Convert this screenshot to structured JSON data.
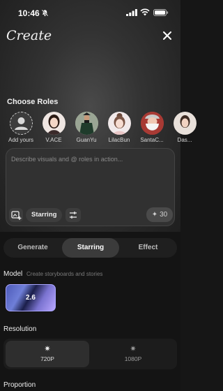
{
  "status_bar": {
    "time": "10:46"
  },
  "header": {
    "title": "Create"
  },
  "roles": {
    "heading": "Choose Roles",
    "items": [
      {
        "label": "Add yours"
      },
      {
        "label": "V.ACE"
      },
      {
        "label": "GuanYu"
      },
      {
        "label": "LilacBun"
      },
      {
        "label": "SantaC..."
      },
      {
        "label": "Das..."
      }
    ]
  },
  "prompt": {
    "placeholder": "Describe visuals and @ roles in action...",
    "starring_label": "Starring",
    "credits": "30"
  },
  "tabs": [
    {
      "label": "Generate",
      "active": false
    },
    {
      "label": "Starring",
      "active": true
    },
    {
      "label": "Effect",
      "active": false
    }
  ],
  "model": {
    "label": "Model",
    "hint": "Create storyboards and stories",
    "version": "2.6"
  },
  "resolution": {
    "label": "Resolution",
    "options": [
      {
        "label": "720P",
        "selected": true
      },
      {
        "label": "1080P",
        "selected": false
      }
    ]
  },
  "proportion": {
    "label": "Proportion"
  },
  "colors": {
    "accent_border": "#a9a6ff",
    "background": "#161616"
  }
}
